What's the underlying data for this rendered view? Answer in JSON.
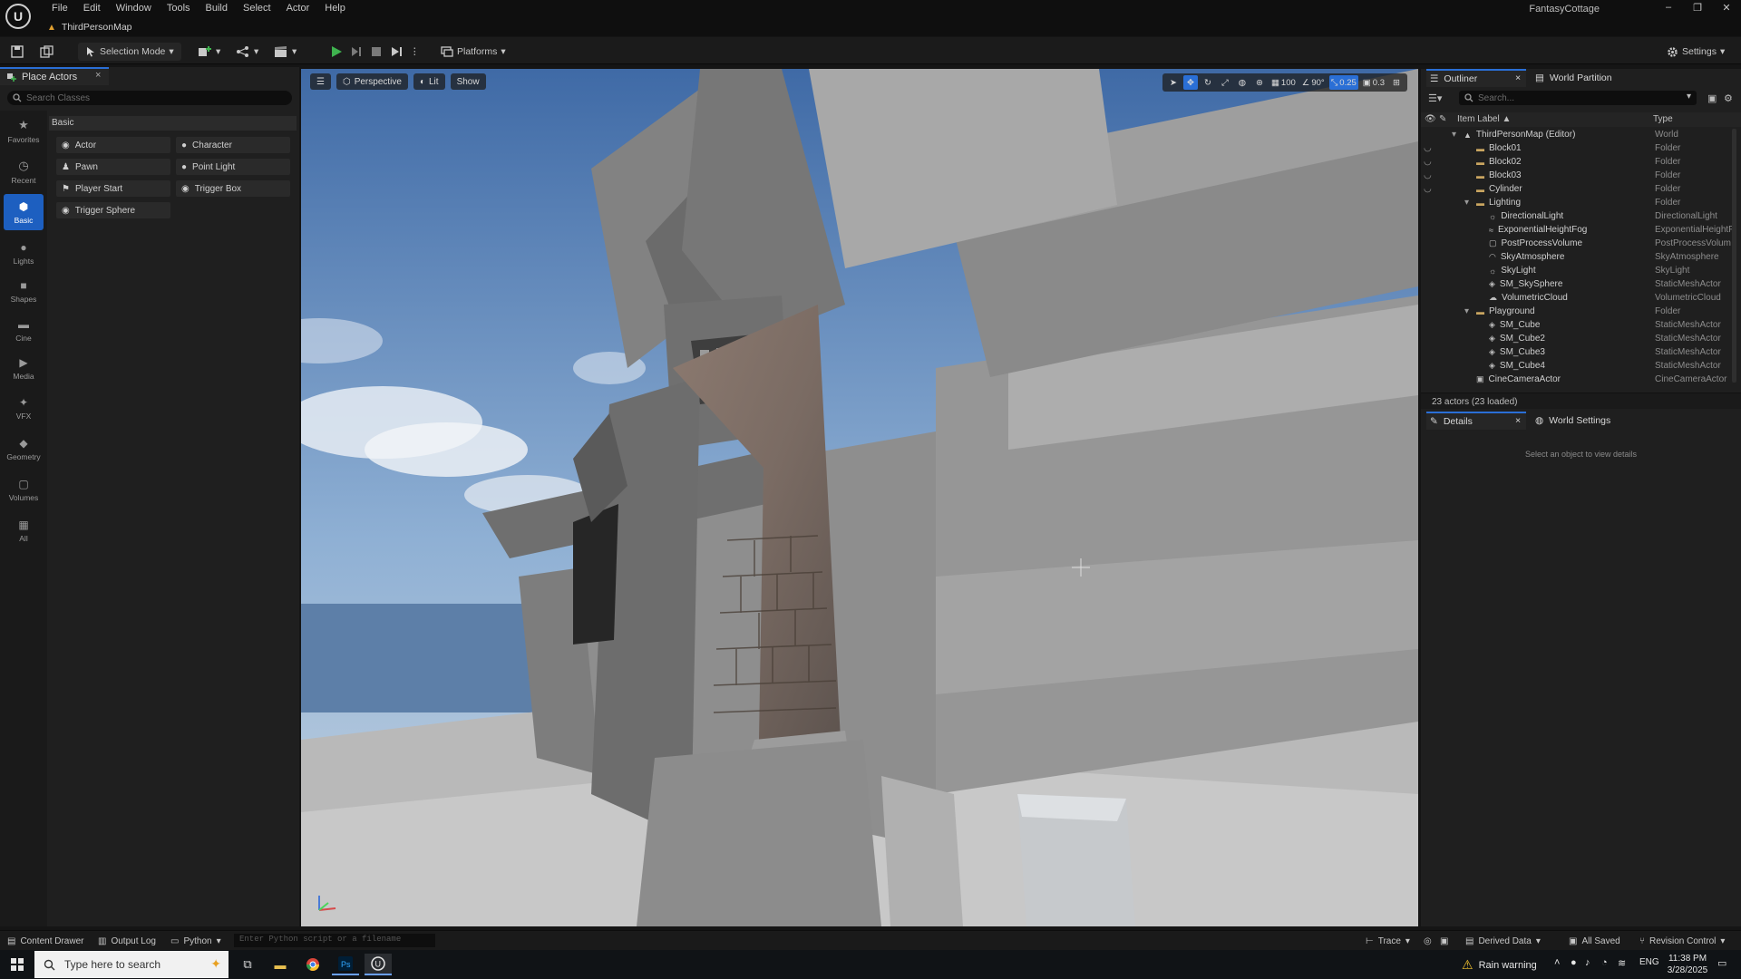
{
  "titlebar": {
    "logo": "U",
    "menu": [
      "File",
      "Edit",
      "Window",
      "Tools",
      "Build",
      "Select",
      "Actor",
      "Help"
    ],
    "map_tab": "ThirdPersonMap",
    "project": "FantasyCottage",
    "window_buttons": [
      "–",
      "❐",
      "✕"
    ]
  },
  "toolbar": {
    "selection_mode": "Selection Mode",
    "platforms": "Platforms",
    "settings": "Settings"
  },
  "place_actors": {
    "tab": "Place Actors",
    "close": "×",
    "search_placeholder": "Search Classes",
    "section": "Basic",
    "categories": [
      "Favorites",
      "Recent",
      "Basic",
      "Lights",
      "Shapes",
      "Cine",
      "Media",
      "VFX",
      "Geometry",
      "Volumes",
      "All"
    ],
    "active_category": "Basic",
    "actors": [
      "Actor",
      "Character",
      "Pawn",
      "Point Light",
      "Player Start",
      "Trigger Box",
      "Trigger Sphere"
    ]
  },
  "viewport": {
    "perspective": "Perspective",
    "lit": "Lit",
    "show": "Show",
    "grid_snap": "100",
    "rot_snap": "90°",
    "scale_snap": "0.25",
    "camera_speed": "0.3"
  },
  "outliner": {
    "tab": "Outliner",
    "tab2": "World Partition",
    "close": "×",
    "search_placeholder": "Search...",
    "col_label": "Item Label ▲",
    "col_type": "Type",
    "rows": [
      {
        "label": "ThirdPersonMap (Editor)",
        "type": "World",
        "indent": 0,
        "icon": "map",
        "expand": "▾",
        "eye": ""
      },
      {
        "label": "Block01",
        "type": "Folder",
        "indent": 1,
        "icon": "folder",
        "expand": "",
        "eye": "◡"
      },
      {
        "label": "Block02",
        "type": "Folder",
        "indent": 1,
        "icon": "folder",
        "expand": "",
        "eye": "◡"
      },
      {
        "label": "Block03",
        "type": "Folder",
        "indent": 1,
        "icon": "folder",
        "expand": "",
        "eye": "◡"
      },
      {
        "label": "Cylinder",
        "type": "Folder",
        "indent": 1,
        "icon": "folder",
        "expand": "",
        "eye": "◡"
      },
      {
        "label": "Lighting",
        "type": "Folder",
        "indent": 1,
        "icon": "folder",
        "expand": "▾",
        "eye": ""
      },
      {
        "label": "DirectionalLight",
        "type": "DirectionalLight",
        "indent": 2,
        "icon": "light",
        "expand": "",
        "eye": ""
      },
      {
        "label": "ExponentialHeightFog",
        "type": "ExponentialHeightF",
        "indent": 2,
        "icon": "fog",
        "expand": "",
        "eye": ""
      },
      {
        "label": "PostProcessVolume",
        "type": "PostProcessVolum",
        "indent": 2,
        "icon": "volume",
        "expand": "",
        "eye": ""
      },
      {
        "label": "SkyAtmosphere",
        "type": "SkyAtmosphere",
        "indent": 2,
        "icon": "sky",
        "expand": "",
        "eye": ""
      },
      {
        "label": "SkyLight",
        "type": "SkyLight",
        "indent": 2,
        "icon": "light",
        "expand": "",
        "eye": ""
      },
      {
        "label": "SM_SkySphere",
        "type": "StaticMeshActor",
        "indent": 2,
        "icon": "mesh",
        "expand": "",
        "eye": ""
      },
      {
        "label": "VolumetricCloud",
        "type": "VolumetricCloud",
        "indent": 2,
        "icon": "cloud",
        "expand": "",
        "eye": ""
      },
      {
        "label": "Playground",
        "type": "Folder",
        "indent": 1,
        "icon": "folder",
        "expand": "▾",
        "eye": ""
      },
      {
        "label": "SM_Cube",
        "type": "StaticMeshActor",
        "indent": 2,
        "icon": "mesh",
        "expand": "",
        "eye": ""
      },
      {
        "label": "SM_Cube2",
        "type": "StaticMeshActor",
        "indent": 2,
        "icon": "mesh",
        "expand": "",
        "eye": ""
      },
      {
        "label": "SM_Cube3",
        "type": "StaticMeshActor",
        "indent": 2,
        "icon": "mesh",
        "expand": "",
        "eye": ""
      },
      {
        "label": "SM_Cube4",
        "type": "StaticMeshActor",
        "indent": 2,
        "icon": "mesh",
        "expand": "",
        "eye": ""
      },
      {
        "label": "CineCameraActor",
        "type": "CineCameraActor",
        "indent": 1,
        "icon": "camera",
        "expand": "",
        "eye": ""
      }
    ],
    "actor_count": "23 actors (23 loaded)"
  },
  "details": {
    "tab": "Details",
    "tab2": "World Settings",
    "close": "×",
    "empty_message": "Select an object to view details"
  },
  "statusbar": {
    "content_drawer": "Content Drawer",
    "output_log": "Output Log",
    "python": "Python",
    "python_placeholder": "Enter Python script or a filename",
    "trace": "Trace",
    "derived_data": "Derived Data",
    "all_saved": "All Saved",
    "revision_control": "Revision Control"
  },
  "taskbar": {
    "search_placeholder": "Type here to search",
    "weather": "Rain warning",
    "lang": "ENG",
    "time": "11:38 PM",
    "date": "3/28/2025"
  },
  "colors": {
    "accent": "#1d5fc0",
    "play": "#3fb34f",
    "folder": "#c9a560"
  }
}
